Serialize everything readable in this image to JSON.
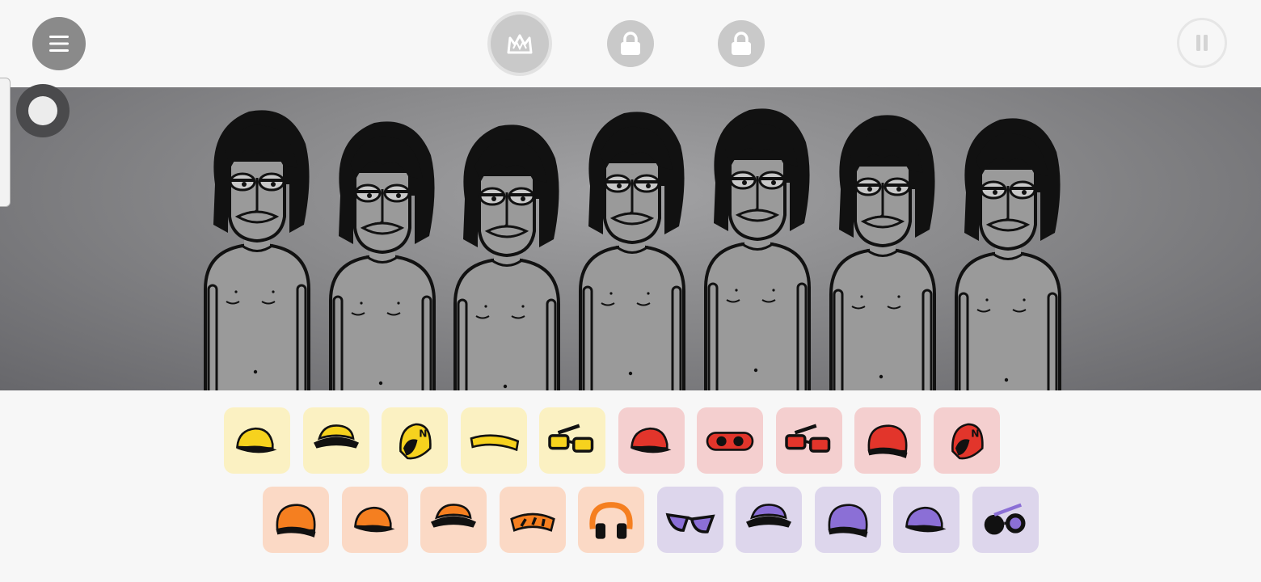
{
  "topbar": {
    "menu_icon": "hamburger-menu-icon",
    "crown_icon": "crown-icon",
    "lock_icon": "lock-icon",
    "pause_icon": "pause-icon"
  },
  "stage": {
    "character_count": 7,
    "record_icon": "record-icon"
  },
  "palette": {
    "colors": {
      "yellow": "#f6d21e",
      "red": "#e2352b",
      "orange": "#f57f20",
      "purple": "#8b6fd6"
    },
    "row1": [
      {
        "name": "yellow-cap-icon",
        "group": "yellow"
      },
      {
        "name": "yellow-hat-icon",
        "group": "yellow"
      },
      {
        "name": "yellow-helmet-icon",
        "group": "yellow"
      },
      {
        "name": "yellow-headband-icon",
        "group": "yellow"
      },
      {
        "name": "yellow-glasses-icon",
        "group": "yellow"
      },
      {
        "name": "red-cap-icon",
        "group": "red"
      },
      {
        "name": "red-goggles-icon",
        "group": "red"
      },
      {
        "name": "red-glasses-icon",
        "group": "red"
      },
      {
        "name": "red-beanie-icon",
        "group": "red"
      },
      {
        "name": "red-helmet-icon",
        "group": "red"
      }
    ],
    "row2": [
      {
        "name": "orange-beanie-icon",
        "group": "orange"
      },
      {
        "name": "orange-cap-icon",
        "group": "orange"
      },
      {
        "name": "orange-hat-icon",
        "group": "orange"
      },
      {
        "name": "orange-visor-icon",
        "group": "orange"
      },
      {
        "name": "orange-headphones-icon",
        "group": "orange"
      },
      {
        "name": "purple-sunglasses-icon",
        "group": "purple"
      },
      {
        "name": "purple-hat-icon",
        "group": "purple"
      },
      {
        "name": "purple-beanie-icon",
        "group": "purple"
      },
      {
        "name": "purple-cap-icon",
        "group": "purple"
      },
      {
        "name": "purple-round-glasses-icon",
        "group": "purple"
      }
    ]
  }
}
